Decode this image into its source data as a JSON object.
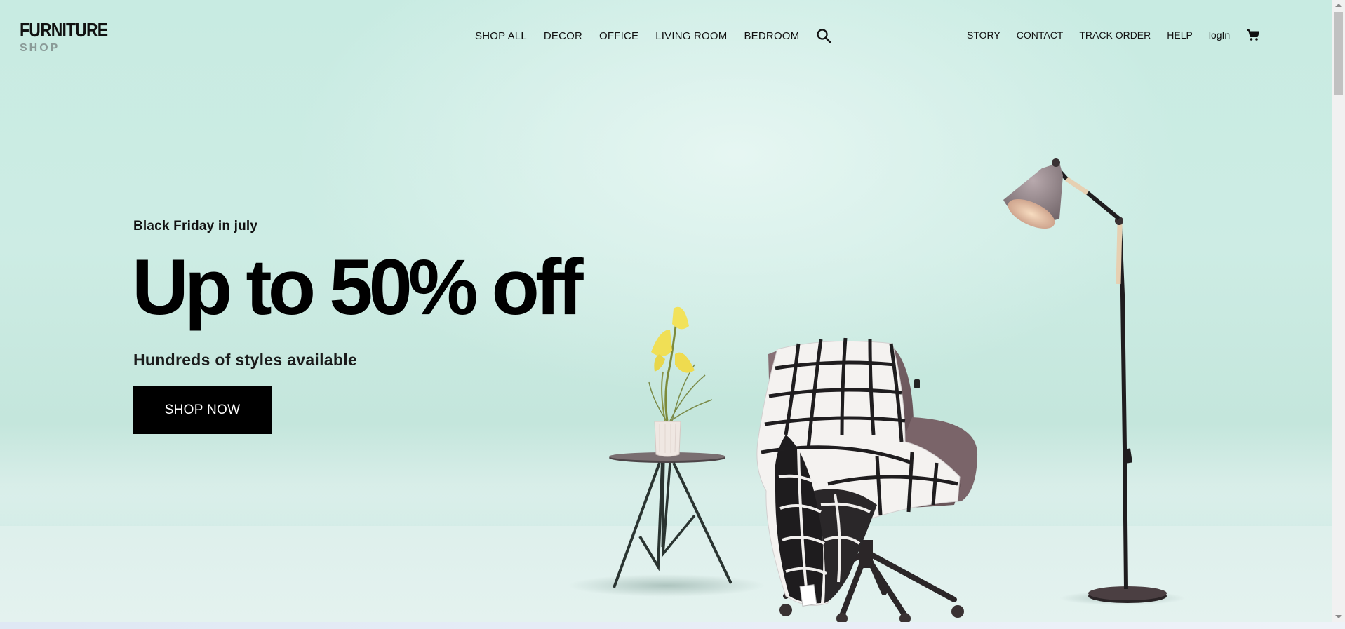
{
  "header": {
    "logo_main": "FURNITURE",
    "logo_sub": "SHOP",
    "main_nav": [
      "SHOP ALL",
      "DECOR",
      "OFFICE",
      "LIVING ROOM",
      "BEDROOM"
    ],
    "util_nav": [
      "STORY",
      "CONTACT",
      "TRACK ORDER",
      "HELP",
      "logIn"
    ]
  },
  "hero": {
    "eyebrow": "Black Friday in july",
    "title": "Up to 50% off",
    "subtitle": "Hundreds of styles available",
    "cta_label": "SHOP NOW"
  },
  "icons": {
    "search": "search-icon",
    "cart": "cart-icon"
  },
  "colors": {
    "background": "#c8ebe2",
    "button": "#000000",
    "button_text": "#ffffff"
  }
}
